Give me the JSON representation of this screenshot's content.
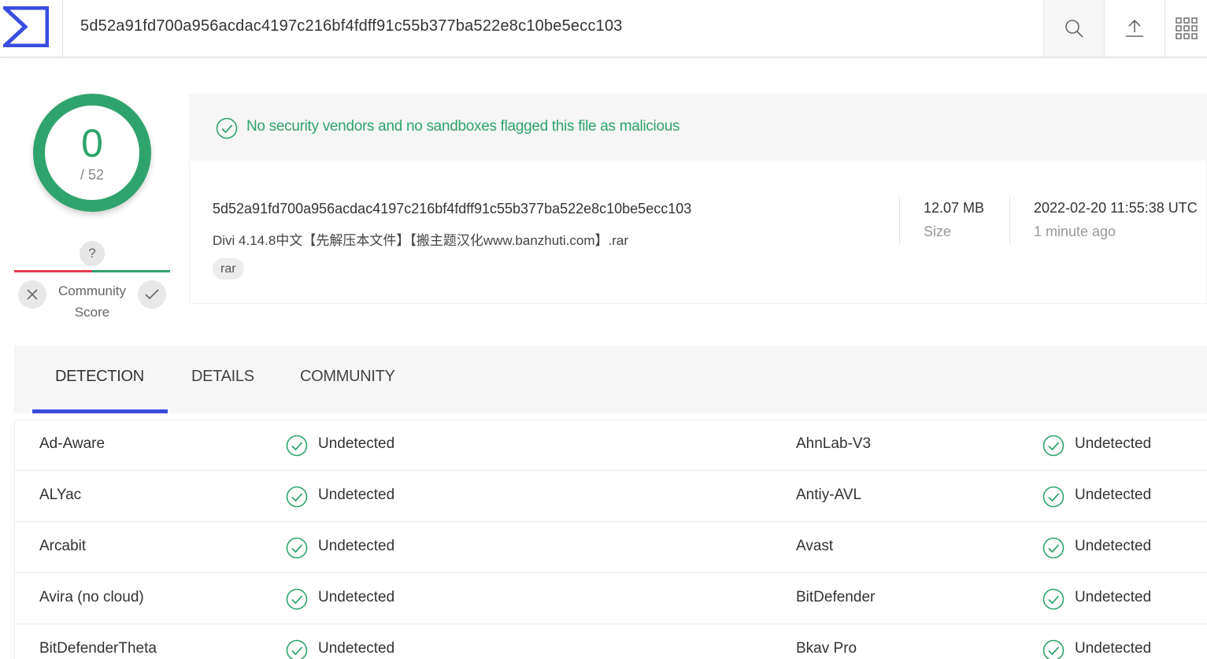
{
  "topbar": {
    "search_value": "5d52a91fd700a956acdac4197c216bf4fdff91c55b377ba522e8c10be5ecc103",
    "icons": [
      "sigma-logo-icon",
      "search-icon",
      "upload-icon",
      "apps-grid-icon"
    ]
  },
  "score": {
    "detections": "0",
    "total": "/ 52",
    "color": "#2fa36d"
  },
  "community": {
    "question": "?",
    "label_line1": "Community",
    "label_line2": "Score"
  },
  "banner": {
    "text": "No security vendors and no sandboxes flagged this file as malicious"
  },
  "file": {
    "hash": "5d52a91fd700a956acdac4197c216bf4fdff91c55b377ba522e8c10be5ecc103",
    "name": "Divi 4.14.8中文【先解压本文件】【搬主题汉化www.banzhuti.com】.rar",
    "tag": "rar",
    "size_value": "12.07 MB",
    "size_label": "Size",
    "date_value": "2022-02-20 11:55:38 UTC",
    "date_label": "1 minute ago"
  },
  "tabs": {
    "detection": "DETECTION",
    "details": "DETAILS",
    "community": "COMMUNITY",
    "accent": "#3a4de0"
  },
  "detections": [
    {
      "left_vendor": "Ad-Aware",
      "left_result": "Undetected",
      "right_vendor": "AhnLab-V3",
      "right_result": "Undetected"
    },
    {
      "left_vendor": "ALYac",
      "left_result": "Undetected",
      "right_vendor": "Antiy-AVL",
      "right_result": "Undetected"
    },
    {
      "left_vendor": "Arcabit",
      "left_result": "Undetected",
      "right_vendor": "Avast",
      "right_result": "Undetected"
    },
    {
      "left_vendor": "Avira (no cloud)",
      "left_result": "Undetected",
      "right_vendor": "BitDefender",
      "right_result": "Undetected"
    },
    {
      "left_vendor": "BitDefenderTheta",
      "left_result": "Undetected",
      "right_vendor": "Bkav Pro",
      "right_result": "Undetected"
    }
  ]
}
